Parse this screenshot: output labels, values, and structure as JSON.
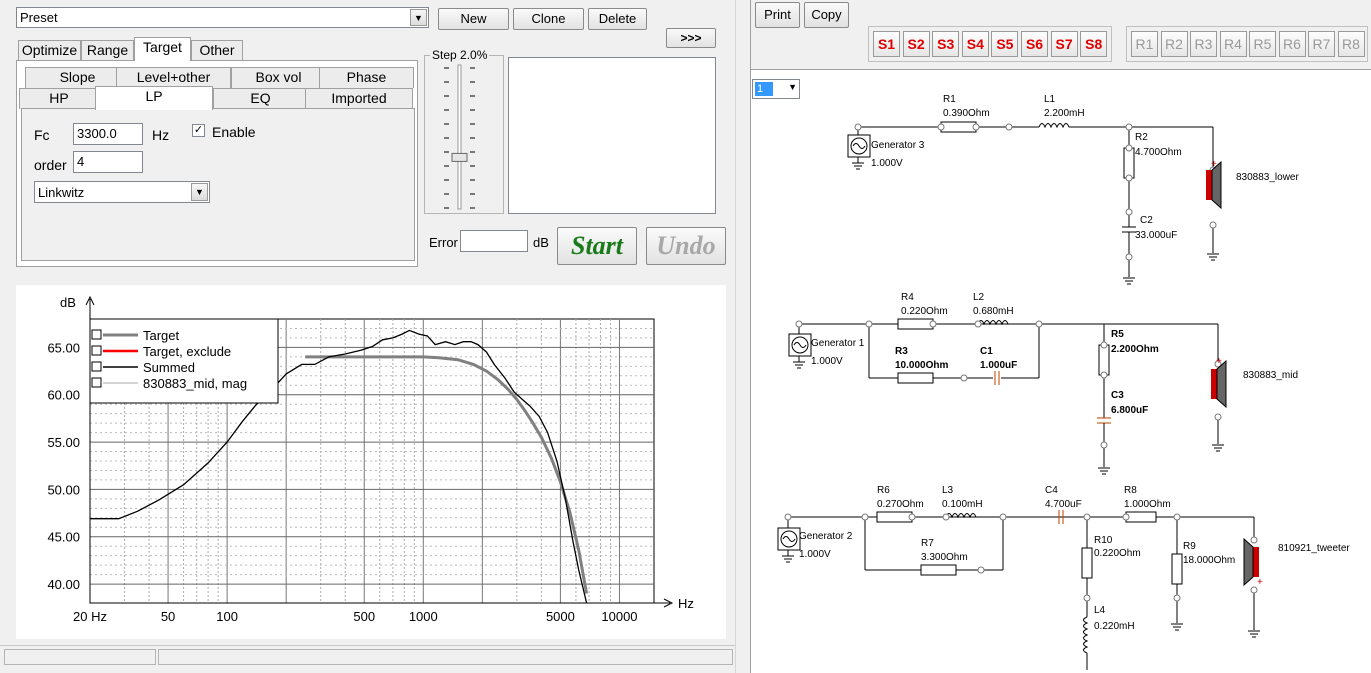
{
  "preset": {
    "value": "Preset"
  },
  "top_buttons": {
    "new": "New",
    "clone": "Clone",
    "delete": "Delete",
    "expand": ">>>"
  },
  "main_tabs": [
    "Optimize",
    "Range",
    "Target",
    "Other"
  ],
  "sub_tabs_row1": [
    "Slope",
    "Level+other",
    "Box vol",
    "Phase"
  ],
  "sub_tabs_row2": [
    "HP",
    "LP",
    "EQ",
    "Imported"
  ],
  "lp": {
    "fc_label": "Fc",
    "fc_value": "3300.0",
    "hz_label": "Hz",
    "enable_label": "Enable",
    "enable_checked": "✓",
    "order_label": "order",
    "order_value": "4",
    "type_value": "Linkwitz"
  },
  "step": {
    "label": "Step 2.0%",
    "position": 0.65
  },
  "error": {
    "label": "Error",
    "unit": "dB",
    "value": ""
  },
  "actions": {
    "start": "Start",
    "undo": "Undo"
  },
  "right_toolbar": {
    "print": "Print",
    "copy": "Copy",
    "s_buttons": [
      "S1",
      "S2",
      "S3",
      "S4",
      "S5",
      "S6",
      "S7",
      "S8"
    ],
    "r_buttons": [
      "R1",
      "R2",
      "R3",
      "R4",
      "R5",
      "R6",
      "R7",
      "R8"
    ],
    "selector_value": "1"
  },
  "colors": {
    "s_active": "#e00000",
    "r_inactive": "#999999",
    "start": "#1a7a1a",
    "undo": "#a8a8a8",
    "target": "#808080",
    "exclude": "#ff0000",
    "summed": "#000000"
  },
  "chart_data": {
    "type": "line",
    "ylabel": "dB",
    "xlabel": "Hz",
    "xscale": "log",
    "xlim": [
      20,
      15000
    ],
    "ylim": [
      38,
      68
    ],
    "ytick_labels": [
      "65.00",
      "60.00",
      "55.00",
      "50.00",
      "45.00",
      "40.00"
    ],
    "yticks": [
      65,
      60,
      55,
      50,
      45,
      40
    ],
    "xtick_labels": [
      "20 Hz",
      "50",
      "100",
      "500",
      "1000",
      "5000",
      "10000"
    ],
    "xticks": [
      20,
      50,
      100,
      500,
      1000,
      5000,
      10000
    ],
    "legend": [
      "Target",
      "Target, exclude",
      "Summed",
      "830883_mid, mag"
    ],
    "legend_position": "top-left",
    "series": [
      {
        "name": "Summed",
        "color": "#000000",
        "x": [
          20,
          28,
          35,
          45,
          60,
          80,
          100,
          120,
          140,
          170,
          200,
          240,
          280,
          330,
          400,
          480,
          550,
          620,
          700,
          780,
          850,
          950,
          1050,
          1150,
          1300,
          1450,
          1600,
          1750,
          1900,
          2100,
          2300,
          2600,
          2900,
          3200,
          3500,
          3900,
          4300,
          4800,
          5300,
          5800,
          6200,
          6800
        ],
        "y": [
          46.9,
          46.9,
          47.7,
          48.9,
          50.5,
          52.8,
          55.0,
          57.2,
          58.9,
          60.6,
          62.2,
          63.2,
          63.2,
          64.0,
          64.3,
          64.7,
          65.1,
          65.8,
          66.0,
          66.4,
          66.8,
          66.4,
          66.2,
          65.3,
          65.6,
          65.3,
          65.6,
          65.6,
          65.3,
          64.5,
          63.2,
          61.8,
          60.3,
          59.5,
          58.8,
          57.7,
          56.0,
          53.0,
          49.0,
          44.5,
          41.5,
          38.0
        ]
      },
      {
        "name": "Target",
        "color": "#808080",
        "x": [
          250,
          400,
          600,
          800,
          1000,
          1200,
          1500,
          1800,
          2100,
          2400,
          2700,
          3000,
          3300,
          3600,
          4000,
          4500,
          5000,
          5600,
          6200,
          6800
        ],
        "y": [
          64.0,
          64.0,
          64.0,
          64.0,
          64.0,
          63.9,
          63.7,
          63.2,
          62.5,
          61.6,
          60.6,
          59.5,
          58.3,
          57.1,
          55.5,
          53.3,
          50.8,
          47.5,
          43.6,
          39.0
        ]
      }
    ]
  },
  "schematic": {
    "branch1": {
      "generator": "Generator 3",
      "gen_value": "1.000V",
      "R1": "R1",
      "R1v": "0.390Ohm",
      "L1": "L1",
      "L1v": "2.200mH",
      "R2": "R2",
      "R2v": "4.700Ohm",
      "C2": "C2",
      "C2v": "33.000uF",
      "speaker": "830883_lower"
    },
    "branch2": {
      "generator": "Generator 1",
      "gen_value": "1.000V",
      "R4": "R4",
      "R4v": "0.220Ohm",
      "L2": "L2",
      "L2v": "0.680mH",
      "R3": "R3",
      "R3v": "10.000Ohm",
      "C1": "C1",
      "C1v": "1.000uF",
      "R5": "R5",
      "R5v": "2.200Ohm",
      "C3": "C3",
      "C3v": "6.800uF",
      "speaker": "830883_mid"
    },
    "branch3": {
      "generator": "Generator 2",
      "gen_value": "1.000V",
      "R6": "R6",
      "R6v": "0.270Ohm",
      "L3": "L3",
      "L3v": "0.100mH",
      "R7": "R7",
      "R7v": "3.300Ohm",
      "C4": "C4",
      "C4v": "4.700uF",
      "R8": "R8",
      "R8v": "1.000Ohm",
      "R10": "R10",
      "R10v": "0.220Ohm",
      "R9": "R9",
      "R9v": "18.000Ohm",
      "L4": "L4",
      "L4v": "0.220mH",
      "speaker": "810921_tweeter"
    }
  }
}
